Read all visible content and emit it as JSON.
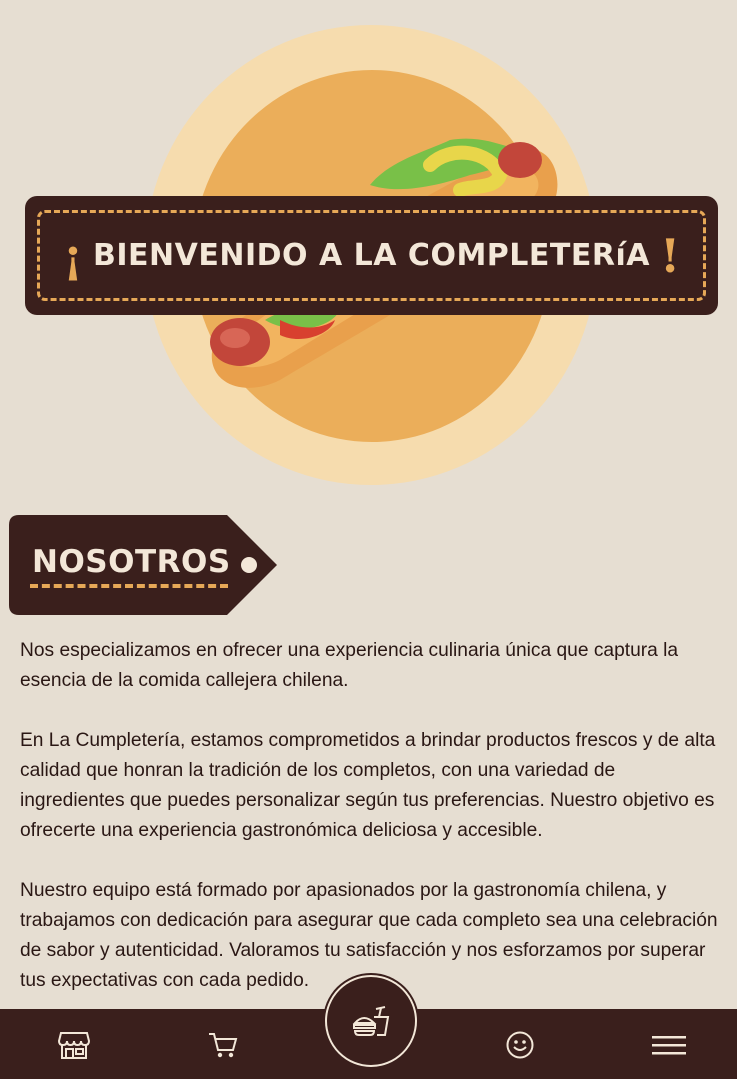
{
  "hero": {
    "title": "BIENVENIDO A LA COMPLETERíA",
    "excl_open": "¡",
    "excl_close": "!"
  },
  "section": {
    "title": "NOSOTROS"
  },
  "paragraphs": [
    "Nos especializamos en ofrecer una experiencia culinaria única que captura la esencia de la comida callejera chilena.",
    "En La Cumpletería, estamos comprometidos a brindar productos frescos y de alta calidad que honran la tradición de los completos, con una variedad de ingredientes que puedes personalizar según tus preferencias. Nuestro objetivo es ofrecerte una experiencia gastronómica deliciosa y accesible.",
    "Nuestro equipo está formado por apasionados por la gastronomía chilena, y trabajamos con dedicación para asegurar que cada completo sea una celebración de sabor y autenticidad. Valoramos tu satisfacción y nos esforzamos por superar tus expectativas con cada pedido."
  ],
  "nav": {
    "items": [
      {
        "icon": "store-icon"
      },
      {
        "icon": "cart-icon"
      },
      {
        "icon": "food-icon"
      },
      {
        "icon": "smiley-icon"
      },
      {
        "icon": "menu-icon"
      }
    ]
  },
  "colors": {
    "background": "#e6ded2",
    "dark_brown": "#3a1f1c",
    "accent": "#e6a857",
    "cream": "#f3e7d8"
  }
}
